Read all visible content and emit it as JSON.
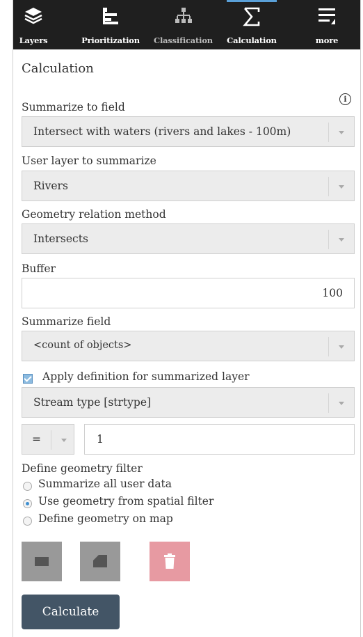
{
  "tabs": [
    {
      "label": "Layers",
      "icon": "layers-icon"
    },
    {
      "label": "Prioritization",
      "icon": "prioritization-icon"
    },
    {
      "label": "Classification",
      "icon": "classification-icon"
    },
    {
      "label": "Calculation",
      "icon": "sigma-icon"
    },
    {
      "label": "more",
      "icon": "more-icon"
    }
  ],
  "panel": {
    "title": "Calculation",
    "info_icon": "info-icon"
  },
  "form": {
    "summarize_to_field_label": "Summarize to field",
    "summarize_to_field_value": "Intersect with waters (rivers and lakes - 100m)",
    "user_layer_label": "User layer to summarize",
    "user_layer_value": "Rivers",
    "geometry_relation_label": "Geometry relation method",
    "geometry_relation_value": "Intersects",
    "buffer_label": "Buffer",
    "buffer_value": "100",
    "summarize_field_label": "Summarize field",
    "summarize_field_value": "<count of objects>",
    "apply_definition_label": "Apply definition for summarized layer",
    "apply_definition_checked": true,
    "definition_field_value": "Stream type [strtype]",
    "operator_value": "=",
    "definition_value": "1"
  },
  "geometry_filter": {
    "label": "Define geometry filter",
    "options": [
      {
        "label": "Summarize all user data",
        "selected": false
      },
      {
        "label": "Use geometry from spatial filter",
        "selected": true
      },
      {
        "label": "Define geometry on map",
        "selected": false
      }
    ]
  },
  "tools": [
    "rectangle-icon",
    "polygon-icon",
    "trash-icon"
  ],
  "actions": {
    "calculate_label": "Calculate"
  },
  "colors": {
    "topbar": "#1f1f1f",
    "active_indicator": "#5aa0d8",
    "primary_button": "#435566",
    "delete_tool": "#e79aa2",
    "disabled_tool": "#999999"
  }
}
